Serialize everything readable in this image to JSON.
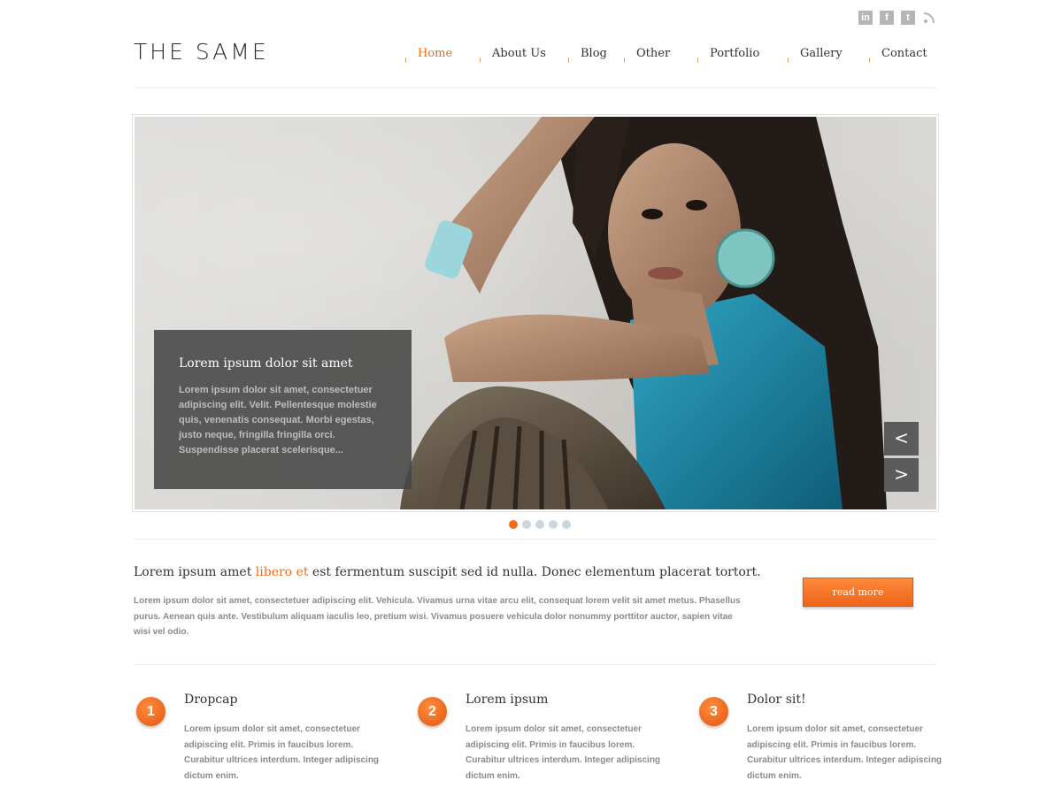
{
  "header": {
    "logo": "THE SAME",
    "social": [
      {
        "icon": "linkedin-icon",
        "glyph": "in"
      },
      {
        "icon": "facebook-icon",
        "glyph": "f"
      },
      {
        "icon": "twitter-icon",
        "glyph": "t"
      },
      {
        "icon": "rss-icon",
        "glyph": ""
      }
    ],
    "nav": [
      "Home",
      "About Us",
      "Blog",
      "Other",
      "Portfolio",
      "Gallery",
      "Contact"
    ],
    "active_nav": "Home"
  },
  "slider": {
    "caption_title": "Lorem ipsum dolor sit amet",
    "caption_text": "Lorem ipsum dolor sit amet, consectetuer adipiscing elit. Velit. Pellentesque molestie quis, venenatis consequat. Morbi egestas, justo neque, fringilla fringilla orci. Suspendisse placerat scelerisque...",
    "prev_label": "<",
    "next_label": ">",
    "dots_count": 5,
    "active_dot": 1
  },
  "intro": {
    "title_before": "Lorem ipsum amet ",
    "title_highlight": "libero et",
    "title_after": " est fermentum suscipit sed id nulla. Donec elementum placerat tortort.",
    "text": "Lorem ipsum dolor sit amet, consectetuer adipiscing elit. Vehicula. Vivamus urna vitae arcu elit, consequat lorem velit sit amet metus. Phasellus purus. Aenean quis ante. Vestibulum aliquam iaculis leo, pretium wisi. Vivamus posuere vehicula dolor nonummy porttitor auctor, sapien vitae wisi vel odio.",
    "button": "read more"
  },
  "features": [
    {
      "number": "1",
      "title": "Dropcap",
      "text": "Lorem ipsum dolor sit amet, consectetuer adipiscing elit. Primis in faucibus lorem. Curabitur ultrices interdum. Integer adipiscing dictum enim."
    },
    {
      "number": "2",
      "title": "Lorem ipsum",
      "text": "Lorem ipsum dolor sit amet, consectetuer adipiscing elit. Primis in faucibus lorem. Curabitur ultrices interdum. Integer adipiscing dictum enim."
    },
    {
      "number": "3",
      "title": "Dolor sit!",
      "text": "Lorem ipsum dolor sit amet, consectetuer adipiscing elit. Primis in faucibus lorem. Curabitur ultrices interdum. Integer adipiscing dictum enim."
    }
  ],
  "colors": {
    "accent": "#ee6d19",
    "text": "#333333",
    "muted": "#8b8b8b"
  }
}
